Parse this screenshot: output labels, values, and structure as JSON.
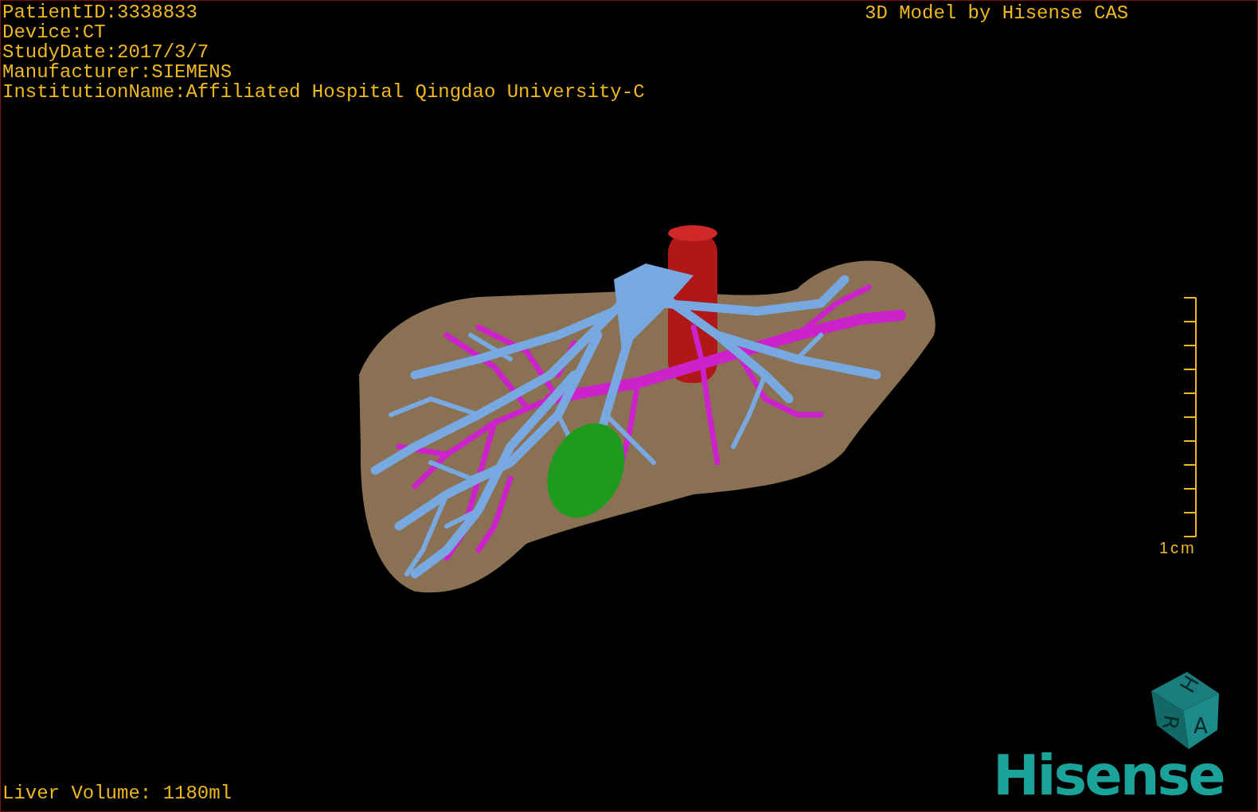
{
  "study_info": [
    "PatientID:3338833",
    "Device:CT",
    "StudyDate:2017/3/7",
    "Manufacturer:SIEMENS",
    "InstitutionName:Affiliated Hospital Qingdao University-C"
  ],
  "credit": "3D Model by Hisense CAS",
  "scale_bar": {
    "label": "1cm"
  },
  "orientation_cube": {
    "faces": [
      "H",
      "R",
      "A"
    ]
  },
  "logo": "Hisense",
  "liver_volume": "Liver Volume: 1180ml"
}
